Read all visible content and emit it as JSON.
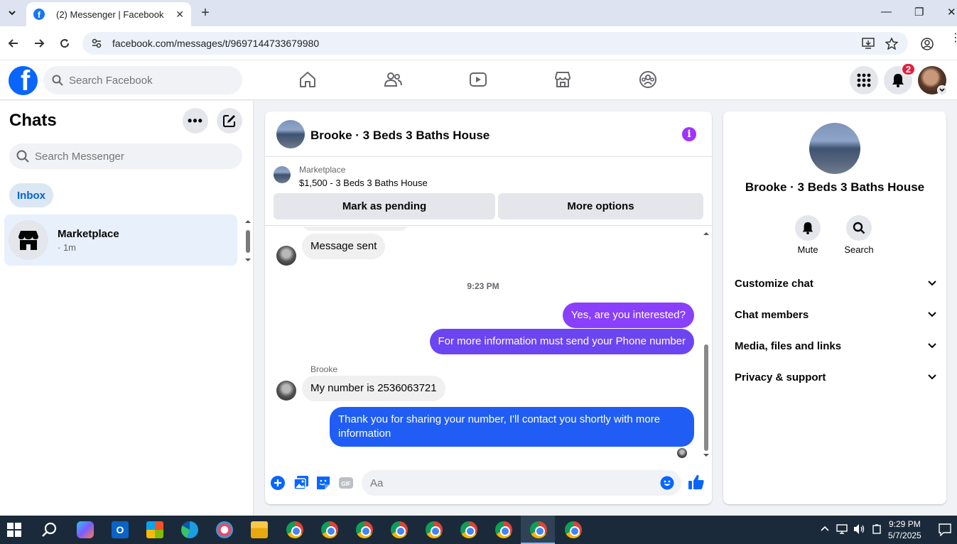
{
  "browser": {
    "tab_title": "(2) Messenger | Facebook",
    "url": "facebook.com/messages/t/9697144733679980"
  },
  "fb": {
    "search_placeholder": "Search Facebook",
    "notification_count": "2"
  },
  "chats": {
    "title": "Chats",
    "search_placeholder": "Search Messenger",
    "filter_label": "Inbox",
    "items": [
      {
        "name": "Marketplace",
        "time": "· 1m"
      }
    ]
  },
  "conversation": {
    "name": "Brooke · 3 Beds 3 Baths House",
    "marketplace": {
      "label": "Marketplace",
      "listing": "$1,500 - 3 Beds 3 Baths House",
      "pending_button": "Mark as pending",
      "more_button": "More options"
    },
    "messages": [
      {
        "from": "them",
        "text": "Message sent"
      },
      {
        "type": "timestamp",
        "text": "9:23 PM"
      },
      {
        "from": "me",
        "text": "Yes, are you interested?"
      },
      {
        "from": "me",
        "text": "For more information must send your Phone number"
      },
      {
        "from": "them",
        "sender": "Brooke",
        "text": "My number is 2536063721"
      },
      {
        "from": "me",
        "text": "Thank you for sharing your number, I'll contact you shortly with more information"
      }
    ],
    "composer_placeholder": "Aa"
  },
  "info_panel": {
    "name": "Brooke · 3 Beds 3 Baths House",
    "actions": [
      "Mute",
      "Search"
    ],
    "sections": [
      "Customize chat",
      "Chat members",
      "Media, files and links",
      "Privacy & support"
    ]
  },
  "taskbar": {
    "time": "9:29 PM",
    "date": "5/7/2025"
  },
  "colors": {
    "fb_blue": "#0866ff",
    "accent_purple": "#a033ff",
    "bubble_out_top": "#8a3ffc",
    "bubble_out_mid": "#6c45f2",
    "bubble_out_bottom": "#1f5df5"
  }
}
